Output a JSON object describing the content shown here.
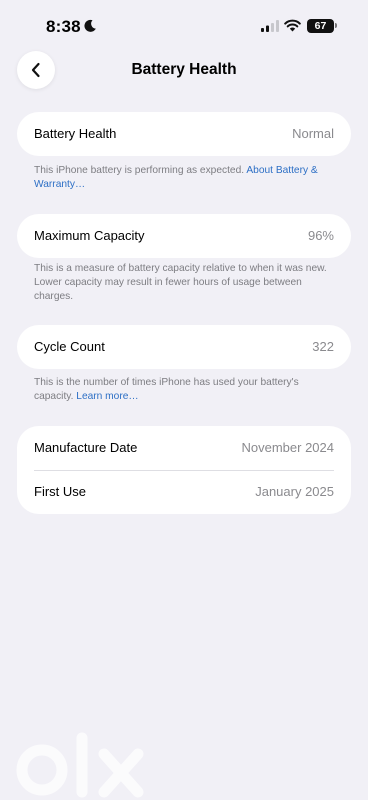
{
  "status_bar": {
    "time": "8:38",
    "battery_level": "67",
    "icons": [
      "moon-icon",
      "cellular-signal-icon",
      "wifi-icon",
      "battery-icon"
    ]
  },
  "nav": {
    "back_icon": "chevron-left-icon",
    "title": "Battery Health"
  },
  "battery_health": {
    "label": "Battery Health",
    "value": "Normal",
    "footnote_text": "This iPhone battery is performing as expected. ",
    "footnote_link": "About Battery & Warranty…"
  },
  "maximum_capacity": {
    "label": "Maximum Capacity",
    "value": "96%",
    "footnote_text": "This is a measure of battery capacity relative to when it was new. Lower capacity may result in fewer hours of usage between charges."
  },
  "cycle_count": {
    "label": "Cycle Count",
    "value": "322",
    "footnote_text": "This is the number of times iPhone has used your battery's capacity. ",
    "footnote_link": "Learn more…"
  },
  "dates": {
    "manufacture_label": "Manufacture Date",
    "manufacture_value": "November 2024",
    "first_use_label": "First Use",
    "first_use_value": "January 2025"
  },
  "colors": {
    "background": "#f1f0f6",
    "card": "#ffffff",
    "link": "#2d6fc5",
    "secondary_text": "#8a8a8e"
  }
}
